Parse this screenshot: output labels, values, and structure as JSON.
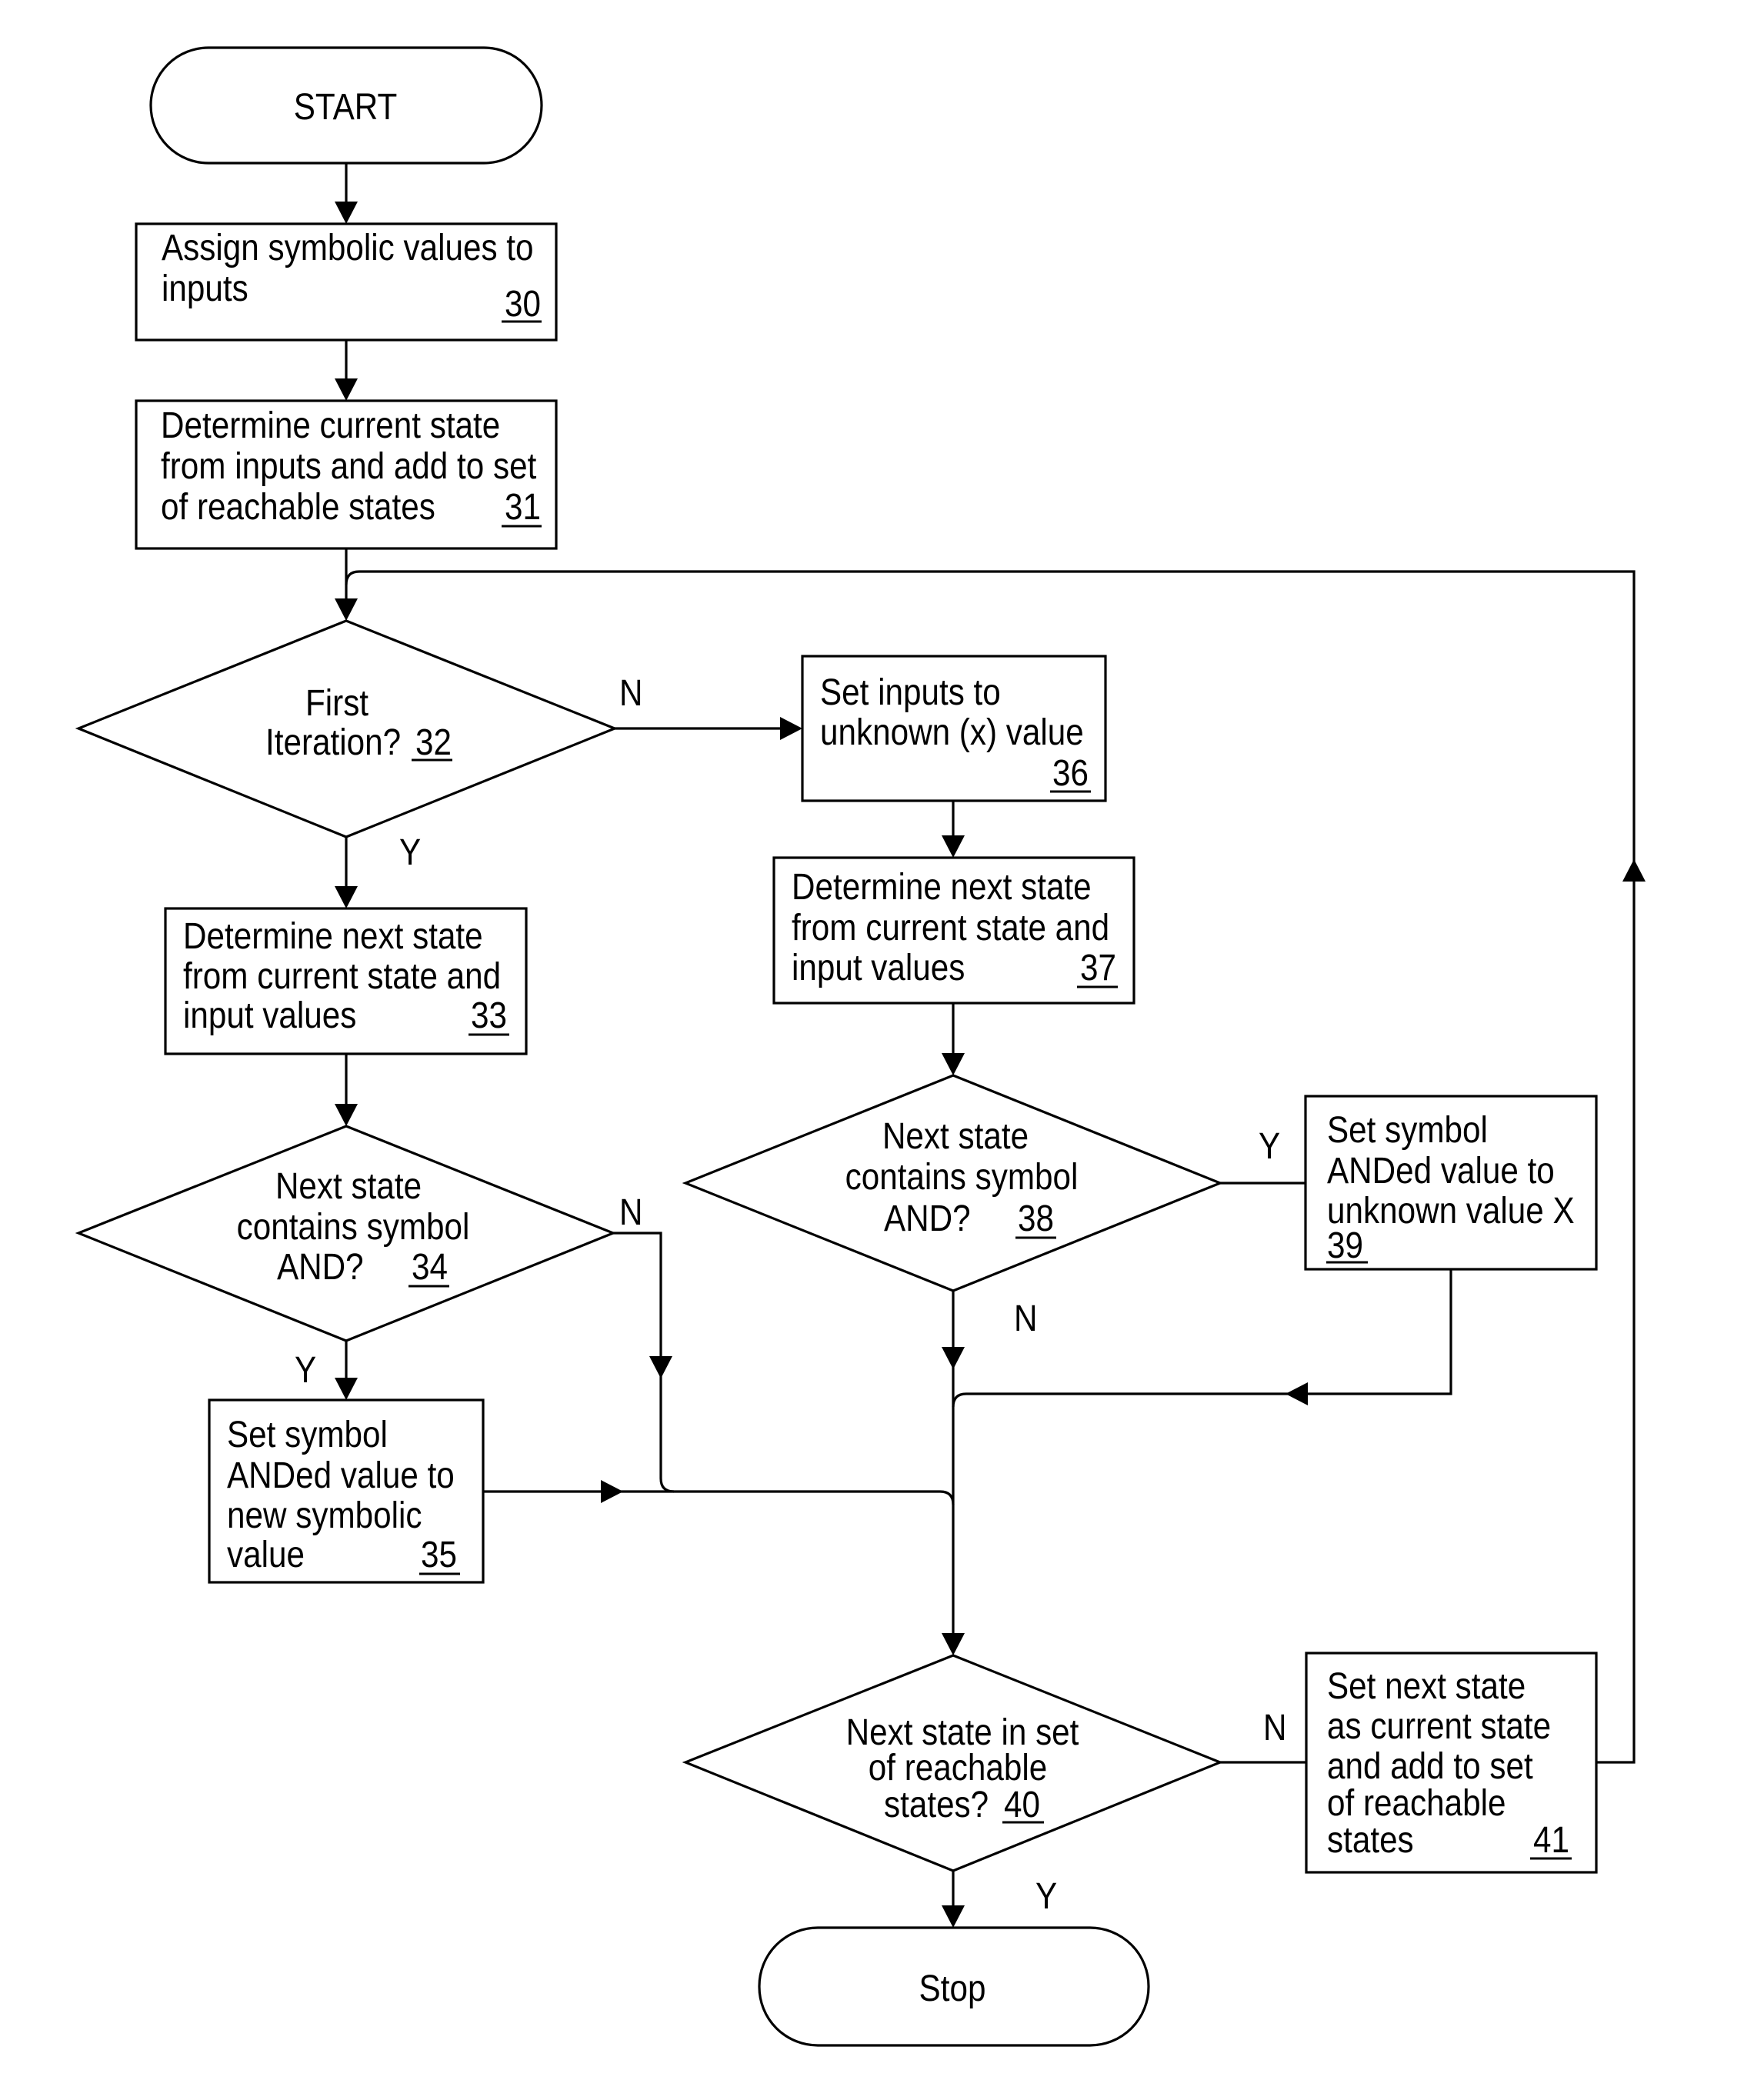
{
  "diagram": {
    "type": "flowchart",
    "nodes": {
      "start": {
        "kind": "terminator",
        "label": "START"
      },
      "n30": {
        "kind": "process",
        "lines": [
          "Assign symbolic values to",
          "inputs"
        ],
        "ref": "30"
      },
      "n31": {
        "kind": "process",
        "lines": [
          "Determine current state",
          "from inputs and add to set",
          "of reachable states"
        ],
        "ref": "31"
      },
      "n32": {
        "kind": "decision",
        "lines": [
          "First",
          "Iteration?"
        ],
        "ref": "32"
      },
      "n33": {
        "kind": "process",
        "lines": [
          "Determine next state",
          "from current state and",
          "input values"
        ],
        "ref": "33"
      },
      "n34": {
        "kind": "decision",
        "lines": [
          "Next state",
          "contains symbol",
          "AND?"
        ],
        "ref": "34"
      },
      "n35": {
        "kind": "process",
        "lines": [
          "Set symbol",
          "ANDed value to",
          "new symbolic",
          "value"
        ],
        "ref": "35"
      },
      "n36": {
        "kind": "process",
        "lines": [
          "Set inputs to",
          "unknown (x) value"
        ],
        "ref": "36"
      },
      "n37": {
        "kind": "process",
        "lines": [
          "Determine next state",
          "from current state and",
          "input values"
        ],
        "ref": "37"
      },
      "n38": {
        "kind": "decision",
        "lines": [
          "Next state",
          "contains symbol",
          "AND?"
        ],
        "ref": "38"
      },
      "n39": {
        "kind": "process",
        "lines": [
          "Set symbol",
          "ANDed value to",
          "unknown value X"
        ],
        "ref": "39"
      },
      "n40": {
        "kind": "decision",
        "lines": [
          "Next state in set",
          "of reachable",
          "states?"
        ],
        "ref": "40"
      },
      "n41": {
        "kind": "process",
        "lines": [
          "Set next state",
          "as current state",
          "and add to set",
          "of reachable",
          "states"
        ],
        "ref": "41"
      },
      "stop": {
        "kind": "terminator",
        "label": "Stop"
      }
    },
    "edge_labels": {
      "e32_no": "N",
      "e32_yes": "Y",
      "e34_no": "N",
      "e34_yes": "Y",
      "e38_yes": "Y",
      "e38_no": "N",
      "e40_no": "N",
      "e40_yes": "Y"
    },
    "edges": [
      {
        "from": "start",
        "to": "n30"
      },
      {
        "from": "n30",
        "to": "n31"
      },
      {
        "from": "n31",
        "to": "n32"
      },
      {
        "from": "n32",
        "to": "n33",
        "label": "Y"
      },
      {
        "from": "n32",
        "to": "n36",
        "label": "N"
      },
      {
        "from": "n33",
        "to": "n34"
      },
      {
        "from": "n34",
        "to": "n35",
        "label": "Y"
      },
      {
        "from": "n34",
        "to": "n40",
        "label": "N"
      },
      {
        "from": "n35",
        "to": "n40"
      },
      {
        "from": "n36",
        "to": "n37"
      },
      {
        "from": "n37",
        "to": "n38"
      },
      {
        "from": "n38",
        "to": "n39",
        "label": "Y"
      },
      {
        "from": "n38",
        "to": "n40",
        "label": "N"
      },
      {
        "from": "n39",
        "to": "n40"
      },
      {
        "from": "n40",
        "to": "n41",
        "label": "N"
      },
      {
        "from": "n40",
        "to": "stop",
        "label": "Y"
      },
      {
        "from": "n41",
        "to": "n32"
      }
    ]
  }
}
